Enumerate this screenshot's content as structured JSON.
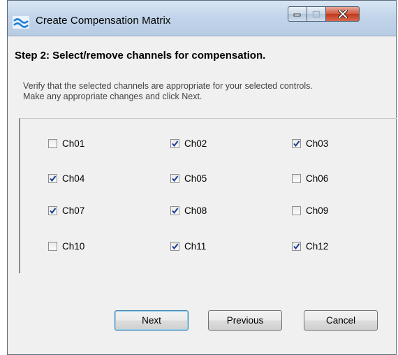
{
  "window": {
    "title": "Create Compensation Matrix",
    "icon": "wave-app-icon",
    "controls": [
      "minimize-icon",
      "maximize-icon",
      "close-icon"
    ]
  },
  "step": {
    "title": "Step 2:  Select/remove channels for compensation.",
    "description_line1": "Verify that the selected channels are appropriate for your selected controls.",
    "description_line2": "Make any appropriate changes and click Next."
  },
  "channels": [
    {
      "label": "Ch01",
      "checked": false
    },
    {
      "label": "Ch02",
      "checked": true
    },
    {
      "label": "Ch03",
      "checked": true
    },
    {
      "label": "Ch04",
      "checked": true
    },
    {
      "label": "Ch05",
      "checked": true
    },
    {
      "label": "Ch06",
      "checked": false
    },
    {
      "label": "Ch07",
      "checked": true
    },
    {
      "label": "Ch08",
      "checked": true
    },
    {
      "label": "Ch09",
      "checked": false
    },
    {
      "label": "Ch10",
      "checked": false
    },
    {
      "label": "Ch11",
      "checked": true
    },
    {
      "label": "Ch12",
      "checked": true
    }
  ],
  "buttons": {
    "next": "Next",
    "previous": "Previous",
    "cancel": "Cancel"
  },
  "colors": {
    "checkmark": "#1a3f8f",
    "title_bar": "#c3d5ea",
    "close_button": "#c9432a"
  }
}
